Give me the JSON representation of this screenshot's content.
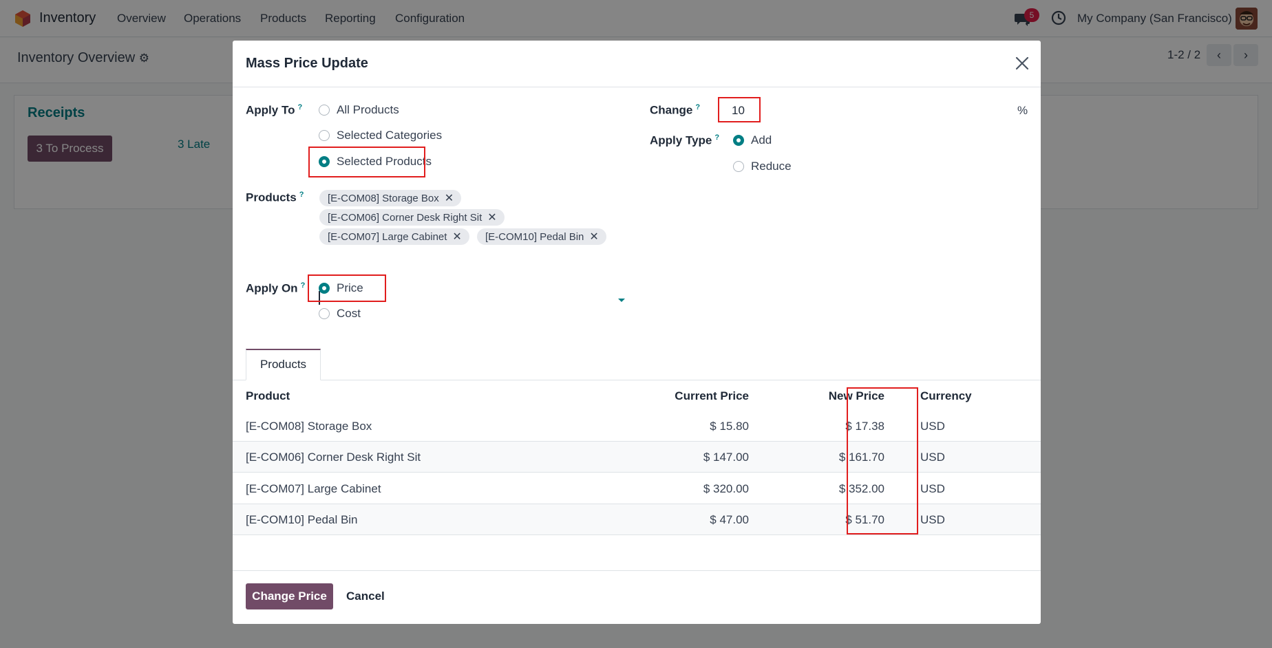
{
  "app": {
    "name": "Inventory",
    "menu": [
      "Overview",
      "Operations",
      "Products",
      "Reporting",
      "Configuration"
    ],
    "chat_badge": "5",
    "company": "My Company (San Francisco)"
  },
  "page": {
    "title": "Inventory Overview",
    "pager": "1-2 / 2"
  },
  "receipts": {
    "title": "Receipts",
    "process_button": "3 To Process",
    "late_link": "3 Late"
  },
  "dialog": {
    "title": "Mass Price Update",
    "apply_to": {
      "label": "Apply To",
      "help": "?",
      "options": [
        "All Products",
        "Selected Categories",
        "Selected Products"
      ],
      "selected": "Selected Products"
    },
    "products_field": {
      "label": "Products",
      "help": "?",
      "tags": [
        "[E-COM08] Storage Box",
        "[E-COM06] Corner Desk Right Sit",
        "[E-COM07] Large Cabinet",
        "[E-COM10] Pedal Bin"
      ]
    },
    "apply_on": {
      "label": "Apply On",
      "help": "?",
      "options": [
        "Price",
        "Cost"
      ],
      "selected": "Price"
    },
    "change": {
      "label": "Change",
      "help": "?",
      "value": "10",
      "unit": "%"
    },
    "apply_type": {
      "label": "Apply Type",
      "help": "?",
      "options": [
        "Add",
        "Reduce"
      ],
      "selected": "Add"
    },
    "tab_label": "Products",
    "table": {
      "headers": [
        "Product",
        "Current Price",
        "New Price",
        "Currency"
      ],
      "rows": [
        {
          "product": "[E-COM08] Storage Box",
          "current": "$ 15.80",
          "new": "$ 17.38",
          "currency": "USD"
        },
        {
          "product": "[E-COM06] Corner Desk Right Sit",
          "current": "$ 147.00",
          "new": "$ 161.70",
          "currency": "USD"
        },
        {
          "product": "[E-COM07] Large Cabinet",
          "current": "$ 320.00",
          "new": "$ 352.00",
          "currency": "USD"
        },
        {
          "product": "[E-COM10] Pedal Bin",
          "current": "$ 47.00",
          "new": "$ 51.70",
          "currency": "USD"
        }
      ]
    },
    "buttons": {
      "confirm": "Change Price",
      "cancel": "Cancel"
    }
  },
  "colors": {
    "brand": "#714b67",
    "accent": "#017e84",
    "highlight": "#e11d1d"
  },
  "icons": [
    "app-logo-icon",
    "chat-icon",
    "clock-icon",
    "gear-icon",
    "chevron-left-icon",
    "chevron-right-icon",
    "close-icon",
    "remove-tag-icon",
    "dropdown-caret-icon"
  ]
}
